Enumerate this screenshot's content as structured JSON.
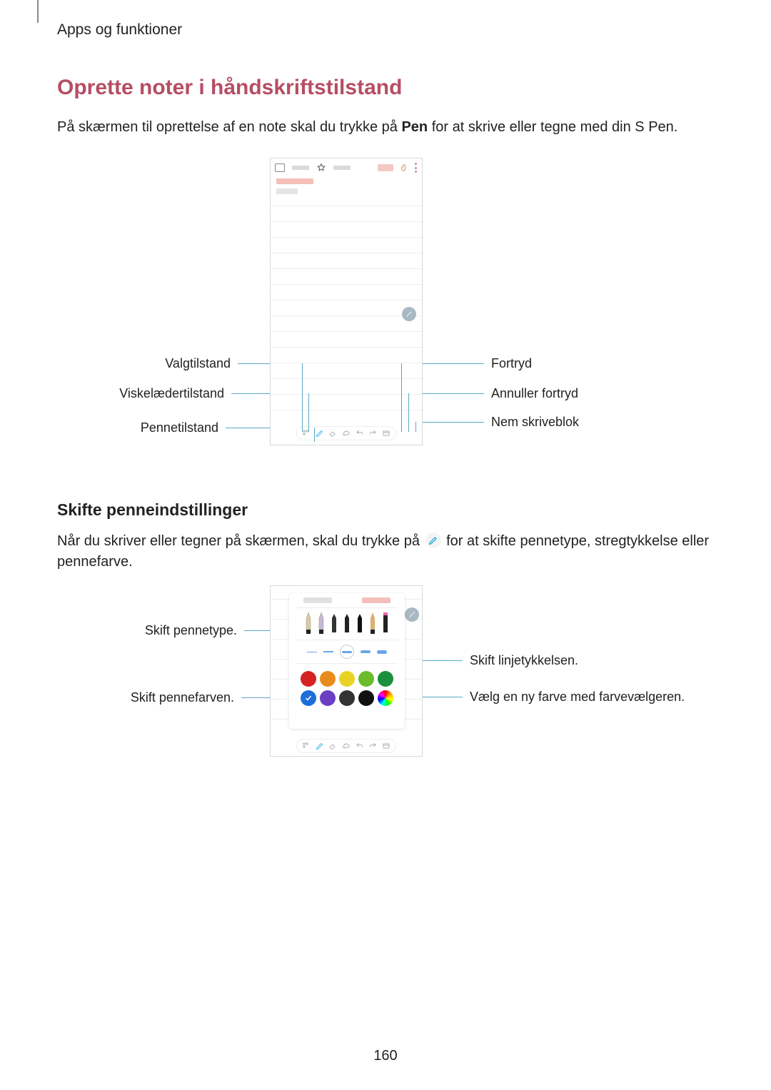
{
  "header": {
    "section": "Apps og funktioner"
  },
  "h2": "Oprette noter i håndskriftstilstand",
  "intro": {
    "before": "På skærmen til oprettelse af en note skal du trykke på ",
    "bold": "Pen",
    "after": " for at skrive eller tegne med din S Pen."
  },
  "callouts1": {
    "valg": "Valgtilstand",
    "visk": "Viskelædertilstand",
    "penne": "Pennetilstand",
    "fort": "Fortryd",
    "annul": "Annuller fortryd",
    "nem": "Nem skriveblok"
  },
  "h3": "Skifte penneindstillinger",
  "para2": {
    "before": "Når du skriver eller tegner på skærmen, skal du trykke på ",
    "after": " for at skifte pennetype, stregtykkelse eller pennefarve."
  },
  "callouts2": {
    "type": "Skift pennetype.",
    "farve": "Skift pennefarven.",
    "linje": "Skift linjetykkelsen.",
    "vaelg": "Vælg en ny farve med farvevælgeren."
  },
  "palette_colors": [
    "#d62222",
    "#e98b1c",
    "#e8d324",
    "#6bbb2b",
    "#1a8f3d",
    "#1c6fdb",
    "#6a3fc2",
    "#333333",
    "#111111"
  ],
  "icons": {
    "select": "select-icon",
    "pen": "pen-icon",
    "eraser": "eraser-icon",
    "cloud": "cloud-icon",
    "undo": "undo-icon",
    "redo": "redo-icon",
    "easypad": "easypad-icon",
    "star": "star-icon",
    "keyboard": "keyboard-icon",
    "attach": "paperclip-icon",
    "more": "more-icon",
    "voice": "voice-icon"
  },
  "page_number": "160"
}
